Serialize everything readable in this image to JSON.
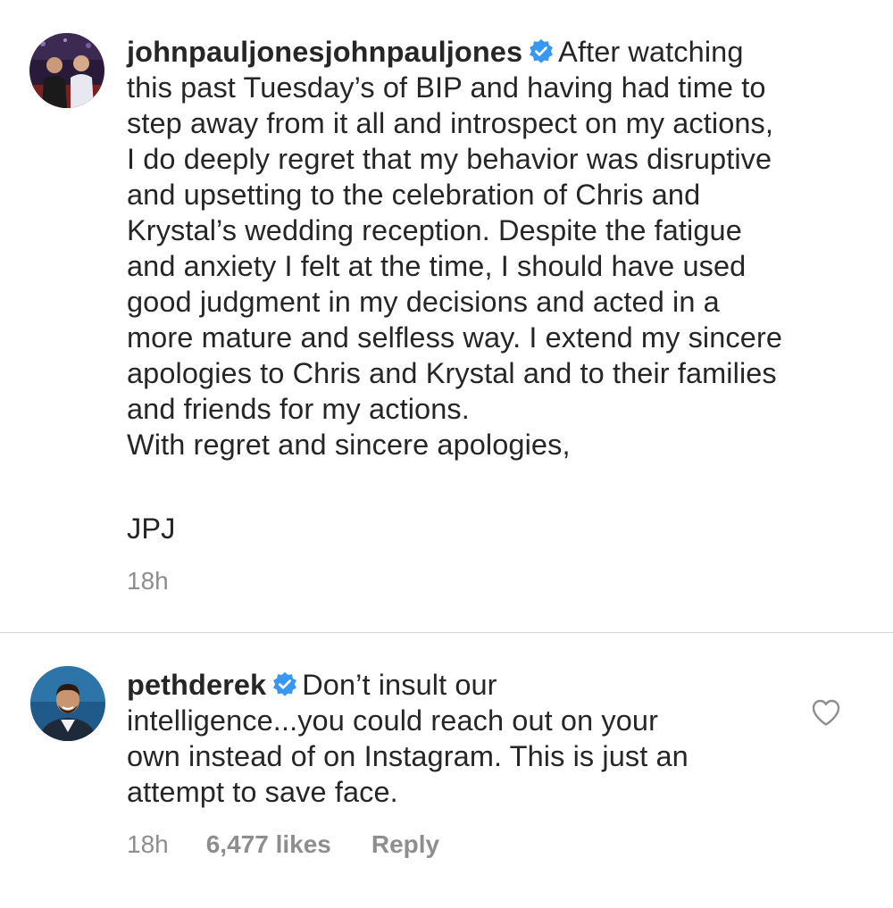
{
  "post": {
    "username": "johnpauljonesjohnpauljones",
    "verified": true,
    "caption_first": "After watching",
    "caption_lines": [
      "this past Tuesday’s of BIP and having had time to",
      "step away from it all and introspect on my actions,",
      "I do deeply regret that my behavior was disruptive",
      "and upsetting to the celebration of Chris and",
      "Krystal’s wedding reception. Despite the fatigue",
      "and anxiety I felt at the time, I should have used",
      "good judgment in my decisions and acted in a",
      "more mature and selfless way.  I extend my sincere",
      "apologies to Chris and Krystal and to their families",
      "and friends for my actions.",
      "With regret and sincere apologies,"
    ],
    "signature": "JPJ",
    "time": "18h"
  },
  "comment": {
    "username": "pethderek",
    "verified": true,
    "text_first": "Don’t insult our",
    "text_lines": [
      "intelligence...you could reach out on your",
      "own instead of on Instagram. This is just an",
      "attempt to save face."
    ],
    "time": "18h",
    "likes": "6,477 likes",
    "reply_label": "Reply"
  },
  "icons": {
    "verified": "verified-badge-icon",
    "like": "heart-outline-icon"
  },
  "colors": {
    "text": "#262626",
    "meta": "#8e8e8e",
    "verified": "#3897f0",
    "divider": "#dbdbdb"
  }
}
